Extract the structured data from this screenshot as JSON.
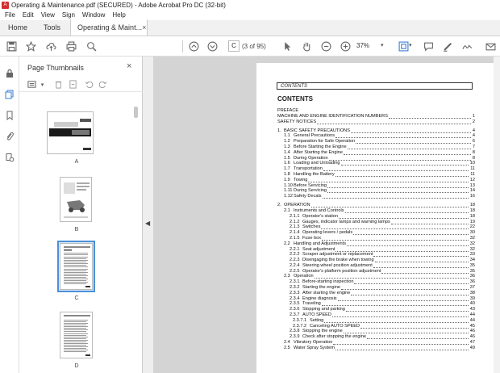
{
  "window": {
    "title": "Operating & Maintenance.pdf (SECURED) - Adobe Acrobat Pro DC (32-bit)"
  },
  "menu": [
    "File",
    "Edit",
    "View",
    "Sign",
    "Window",
    "Help"
  ],
  "tabs": {
    "home": "Home",
    "tools": "Tools",
    "document": "Operating & Maint...",
    "close": "×"
  },
  "toolbar": {
    "current_page": "C",
    "page_count": "(3 of 95)",
    "zoom": "37%"
  },
  "thumbnails_panel": {
    "title": "Page Thumbnails",
    "close": "×",
    "pages": [
      {
        "label": "A"
      },
      {
        "label": "B"
      },
      {
        "label": "C",
        "selected": true
      },
      {
        "label": "D"
      }
    ]
  },
  "document": {
    "header_box": "CONTENTS",
    "title": "CONTENTS",
    "toc": [
      {
        "type": "plain",
        "text": "PREFACE",
        "page": ""
      },
      {
        "type": "plain",
        "text": "MACHINE AND ENGINE IDENTIFICATION NUMBERS",
        "page": "1"
      },
      {
        "type": "plain",
        "text": "SAFETY NOTICES",
        "page": "2"
      },
      {
        "type": "gap"
      },
      {
        "type": "h1",
        "num": "1.",
        "text": "BASIC SAFETY PRECAUTIONS",
        "page": "4"
      },
      {
        "type": "h2",
        "num": "1.1",
        "text": "General Precautions",
        "page": "4"
      },
      {
        "type": "h2",
        "num": "1.2",
        "text": "Preparation for Safe Operation",
        "page": "6"
      },
      {
        "type": "h2",
        "num": "1.3",
        "text": "Before Starting the Engine",
        "page": "7"
      },
      {
        "type": "h2",
        "num": "1.4",
        "text": "After Starting the Engine",
        "page": "8"
      },
      {
        "type": "h2",
        "num": "1.5",
        "text": "During Operation",
        "page": "8"
      },
      {
        "type": "h2",
        "num": "1.6",
        "text": "Loading and Unloading",
        "page": "10"
      },
      {
        "type": "h2",
        "num": "1.7",
        "text": "Transportation",
        "page": "11"
      },
      {
        "type": "h2",
        "num": "1.8",
        "text": "Handling the Battery",
        "page": "11"
      },
      {
        "type": "h2",
        "num": "1.9",
        "text": "Towing",
        "page": "12"
      },
      {
        "type": "h2",
        "num": "1.10",
        "text": "Before Servicing",
        "page": "13"
      },
      {
        "type": "h2",
        "num": "1.11",
        "text": "During Servicing",
        "page": "14"
      },
      {
        "type": "h2",
        "num": "1.12",
        "text": "Safety Decals",
        "page": "16"
      },
      {
        "type": "gap"
      },
      {
        "type": "h1",
        "num": "2.",
        "text": "OPERATION",
        "page": "18"
      },
      {
        "type": "h2",
        "num": "2.1",
        "text": "Instruments and Controls",
        "page": "18"
      },
      {
        "type": "h3",
        "num": "2.1.1",
        "text": "Operator's station",
        "page": "18"
      },
      {
        "type": "h3",
        "num": "2.1.2",
        "text": "Gauges, indicator lamps and warning lamps",
        "page": "19"
      },
      {
        "type": "h3",
        "num": "2.1.3",
        "text": "Switches",
        "page": "22"
      },
      {
        "type": "h3",
        "num": "2.1.4",
        "text": "Operating levers / pedals",
        "page": "30"
      },
      {
        "type": "h3",
        "num": "2.1.5",
        "text": "Fuse box",
        "page": "32"
      },
      {
        "type": "h2",
        "num": "2.2",
        "text": "Handling and Adjustments",
        "page": "32"
      },
      {
        "type": "h3",
        "num": "2.2.1",
        "text": "Seat adjustment",
        "page": "32"
      },
      {
        "type": "h3",
        "num": "2.2.2",
        "text": "Scraper adjustment or replacement",
        "page": "33"
      },
      {
        "type": "h3",
        "num": "2.2.3",
        "text": "Disengaging the brake when towing",
        "page": "34"
      },
      {
        "type": "h3",
        "num": "2.2.4",
        "text": "Steering wheel position adjustment",
        "page": "35"
      },
      {
        "type": "h3",
        "num": "2.2.5",
        "text": "Operator's platform position adjustment",
        "page": "35"
      },
      {
        "type": "h2",
        "num": "2.3",
        "text": "Operation",
        "page": "36"
      },
      {
        "type": "h3",
        "num": "2.3.1",
        "text": "Before-starting inspection",
        "page": "36"
      },
      {
        "type": "h3",
        "num": "2.3.2",
        "text": "Starting the engine",
        "page": "37"
      },
      {
        "type": "h3",
        "num": "2.3.3",
        "text": "After starting the engine",
        "page": "38"
      },
      {
        "type": "h3",
        "num": "2.3.4",
        "text": "Engine diagnosis",
        "page": "39"
      },
      {
        "type": "h3",
        "num": "2.3.5",
        "text": "Traveling",
        "page": "40"
      },
      {
        "type": "h3",
        "num": "2.3.6",
        "text": "Stopping and parking",
        "page": "43"
      },
      {
        "type": "h3",
        "num": "2.3.7",
        "text": "AUTO SPEED",
        "page": "44"
      },
      {
        "type": "h4",
        "num": "2.3.7.1",
        "text": "Setting",
        "page": "44"
      },
      {
        "type": "h4",
        "num": "2.3.7.2",
        "text": "Canceling AUTO SPEED",
        "page": "45"
      },
      {
        "type": "h3",
        "num": "2.3.8",
        "text": "Stopping the engine",
        "page": "46"
      },
      {
        "type": "h3",
        "num": "2.3.9",
        "text": "Check after stopping the engine",
        "page": "46"
      },
      {
        "type": "h2",
        "num": "2.4",
        "text": "Vibratory Operation",
        "page": "47"
      },
      {
        "type": "h2",
        "num": "2.5",
        "text": "Water Spray System",
        "page": "49"
      }
    ]
  }
}
